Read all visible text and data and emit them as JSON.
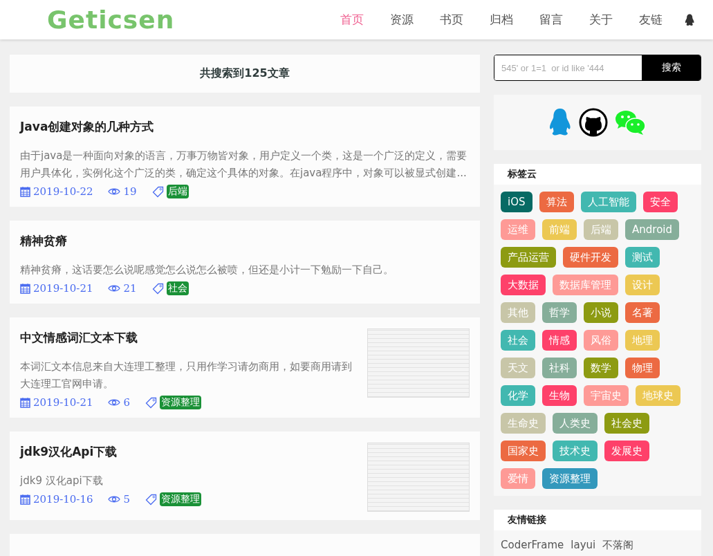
{
  "header": {
    "logo": "Geticsen",
    "nav": [
      {
        "label": "首页",
        "selected": true
      },
      {
        "label": "资源",
        "selected": false
      },
      {
        "label": "书页",
        "selected": false
      },
      {
        "label": "归档",
        "selected": false
      },
      {
        "label": "留言",
        "selected": false
      },
      {
        "label": "关于",
        "selected": false
      },
      {
        "label": "友链",
        "selected": false
      }
    ]
  },
  "search_result": "共搜索到125文章",
  "articles": [
    {
      "title": "Java创建对象的几种方式",
      "summary": "由于java是一种面向对象的语言，万事万物皆对象，用户定义一个类，这是一个广泛的定义，需要用户具体化，实例化这个广泛的类，确定这个具体的对象。在java程序中，对象可以被显式创建...",
      "date": "2019-10-22",
      "views": "19",
      "tag": "后端",
      "thumbnail": false
    },
    {
      "title": "精神贫瘠",
      "summary": "精神贫瘠，这话要怎么说呢感觉怎么说怎么被喷，但还是小计一下勉励一下自己。",
      "date": "2019-10-21",
      "views": "21",
      "tag": "社会",
      "thumbnail": false
    },
    {
      "title": "中文情感词汇文本下载",
      "summary": "本词汇文本信息来自大连理工整理，只用作学习请勿商用，如要商用请到大连理工官网申请。",
      "date": "2019-10-21",
      "views": "6",
      "tag": "资源整理",
      "thumbnail": true
    },
    {
      "title": "jdk9汉化Api下载",
      "summary": "jdk9 汉化api下载",
      "date": "2019-10-16",
      "views": "5",
      "tag": "资源整理",
      "thumbnail": true
    }
  ],
  "search": {
    "placeholder": "545' or 1=1  or id like '444",
    "button": "搜索"
  },
  "tag_cloud": {
    "title": "标签云",
    "tags": [
      {
        "label": "iOS",
        "color": "#076a64"
      },
      {
        "label": "算法",
        "color": "#ec6a42"
      },
      {
        "label": "人工智能",
        "color": "#42b8b0"
      },
      {
        "label": "安全",
        "color": "#fe416a"
      },
      {
        "label": "运维",
        "color": "#fe9a96"
      },
      {
        "label": "前端",
        "color": "#ecc853"
      },
      {
        "label": "后端",
        "color": "#c8c6a8"
      },
      {
        "label": "Android",
        "color": "#86ae9a"
      },
      {
        "label": "产品运营",
        "color": "#8d9b12"
      },
      {
        "label": "硬件开发",
        "color": "#ec6a42"
      },
      {
        "label": "测试",
        "color": "#42b8b0"
      },
      {
        "label": "大数据",
        "color": "#fe416a"
      },
      {
        "label": "数据库管理",
        "color": "#fe9a96"
      },
      {
        "label": "设计",
        "color": "#ecc853"
      },
      {
        "label": "其他",
        "color": "#c8c6a8"
      },
      {
        "label": "哲学",
        "color": "#86ae9a"
      },
      {
        "label": "小说",
        "color": "#8d9b12"
      },
      {
        "label": "名著",
        "color": "#ec6a42"
      },
      {
        "label": "社会",
        "color": "#42b8b0"
      },
      {
        "label": "情感",
        "color": "#fe416a"
      },
      {
        "label": "风俗",
        "color": "#fe9a96"
      },
      {
        "label": "地理",
        "color": "#ecc853"
      },
      {
        "label": "天文",
        "color": "#c8c6a8"
      },
      {
        "label": "社科",
        "color": "#86ae9a"
      },
      {
        "label": "数学",
        "color": "#8d9b12"
      },
      {
        "label": "物理",
        "color": "#ec6a42"
      },
      {
        "label": "化学",
        "color": "#42b8b0"
      },
      {
        "label": "生物",
        "color": "#fe416a"
      },
      {
        "label": "宇宙史",
        "color": "#fe9a96"
      },
      {
        "label": "地球史",
        "color": "#ecc853"
      },
      {
        "label": "生命史",
        "color": "#c8c6a8"
      },
      {
        "label": "人类史",
        "color": "#86ae9a"
      },
      {
        "label": "社会史",
        "color": "#8d9b12"
      },
      {
        "label": "国家史",
        "color": "#ec6a42"
      },
      {
        "label": "技术史",
        "color": "#42b8b0"
      },
      {
        "label": "发展史",
        "color": "#fe416a"
      },
      {
        "label": "爱情",
        "color": "#fe9a96"
      },
      {
        "label": "资源整理",
        "color": "#3398bc"
      }
    ]
  },
  "friend_links": {
    "title": "友情链接",
    "links": [
      "CoderFrame",
      "layui",
      "不落阁"
    ]
  }
}
